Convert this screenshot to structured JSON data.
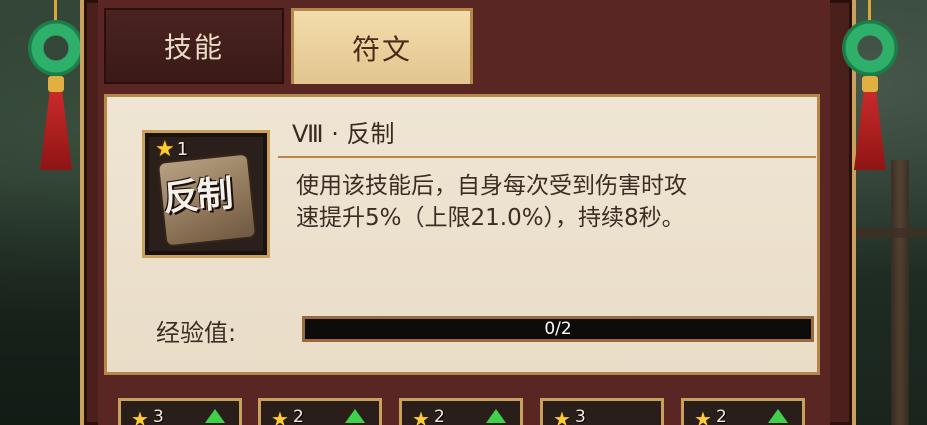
{
  "tabs": [
    {
      "label": "技能",
      "active": false
    },
    {
      "label": "符文",
      "active": true
    }
  ],
  "rune": {
    "title": "Ⅷ · 反制",
    "icon_text": "反制",
    "stars": 1,
    "description_line1": "使用该技能后，自身每次受到伤害时攻",
    "description_line2": "速提升5%（上限21.0%），持续8秒。"
  },
  "experience": {
    "label": "经验值:",
    "current": 0,
    "max": 2,
    "text": "0/2"
  },
  "slots": [
    {
      "stars": "3",
      "upgrade": true
    },
    {
      "stars": "2",
      "upgrade": true
    },
    {
      "stars": "2",
      "upgrade": true
    },
    {
      "stars": "3",
      "upgrade": false
    },
    {
      "stars": "2",
      "upgrade": true
    }
  ],
  "colors": {
    "frame_gold": "#c9a15a",
    "panel_bg": "#efe5d3",
    "active_tab": "#f3dcab",
    "upgrade_arrow": "#3fd14a",
    "star": "#ffcc33"
  }
}
